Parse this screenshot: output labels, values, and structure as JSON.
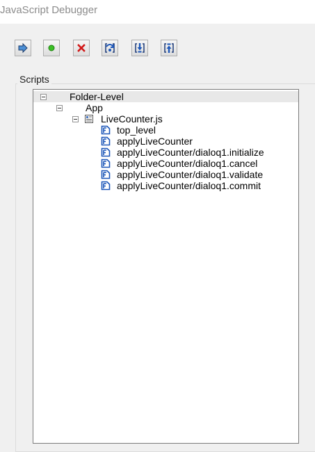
{
  "window": {
    "title": "JavaScript Debugger"
  },
  "toolbar": {
    "buttons": [
      {
        "name": "resume",
        "icon": "resume-arrow-icon"
      },
      {
        "name": "pause",
        "icon": "green-dot-icon"
      },
      {
        "name": "quit",
        "icon": "red-x-icon"
      },
      {
        "name": "step-over",
        "icon": "step-over-icon"
      },
      {
        "name": "step-into",
        "icon": "step-into-icon"
      },
      {
        "name": "step-out",
        "icon": "step-out-icon"
      }
    ]
  },
  "scripts": {
    "legend": "Scripts",
    "tree": {
      "root": "Folder-Level",
      "app": "App",
      "file": "LiveCounter.js",
      "functions": [
        "top_level",
        "applyLiveCounter",
        "applyLiveCounter/dialoq1.initialize",
        "applyLiveCounter/dialoq1.cancel",
        "applyLiveCounter/dialoq1.validate",
        "applyLiveCounter/dialoq1.commit"
      ]
    }
  },
  "colors": {
    "icon_blue": "#1c56b8",
    "accent_green": "#3bbf25",
    "accent_red": "#d11818"
  }
}
